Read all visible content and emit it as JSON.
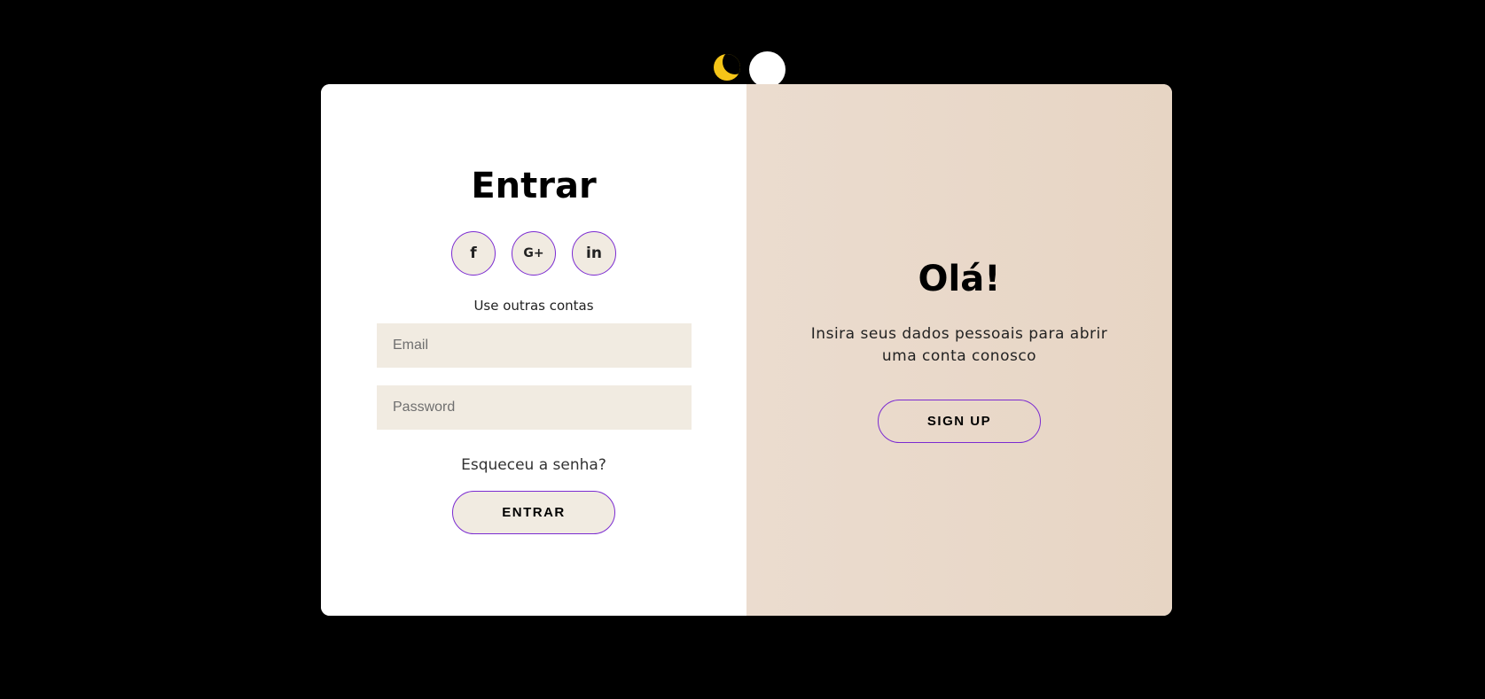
{
  "theme_toggle": {
    "moon_icon": "moon-icon",
    "moon_color": "#f5c518"
  },
  "signin": {
    "title": "Entrar",
    "social": [
      {
        "label": "f",
        "icon": "facebook-icon"
      },
      {
        "label": "G+",
        "icon": "google-plus-icon"
      },
      {
        "label": "in",
        "icon": "linkedin-icon"
      }
    ],
    "other_accounts": "Use outras contas",
    "email_placeholder": "Email",
    "password_placeholder": "Password",
    "forgot": "Esqueceu a senha?",
    "submit_label": "ENTRAR"
  },
  "overlay": {
    "title": "Olá!",
    "subtitle": "Insira seus dados pessoais para abrir uma conta conosco",
    "signup_label": "SIGN UP"
  },
  "colors": {
    "accent_border": "#7b2bd1",
    "input_bg": "#f1ebe1",
    "overlay_bg": "#e9d9ca",
    "page_bg": "#000000"
  }
}
